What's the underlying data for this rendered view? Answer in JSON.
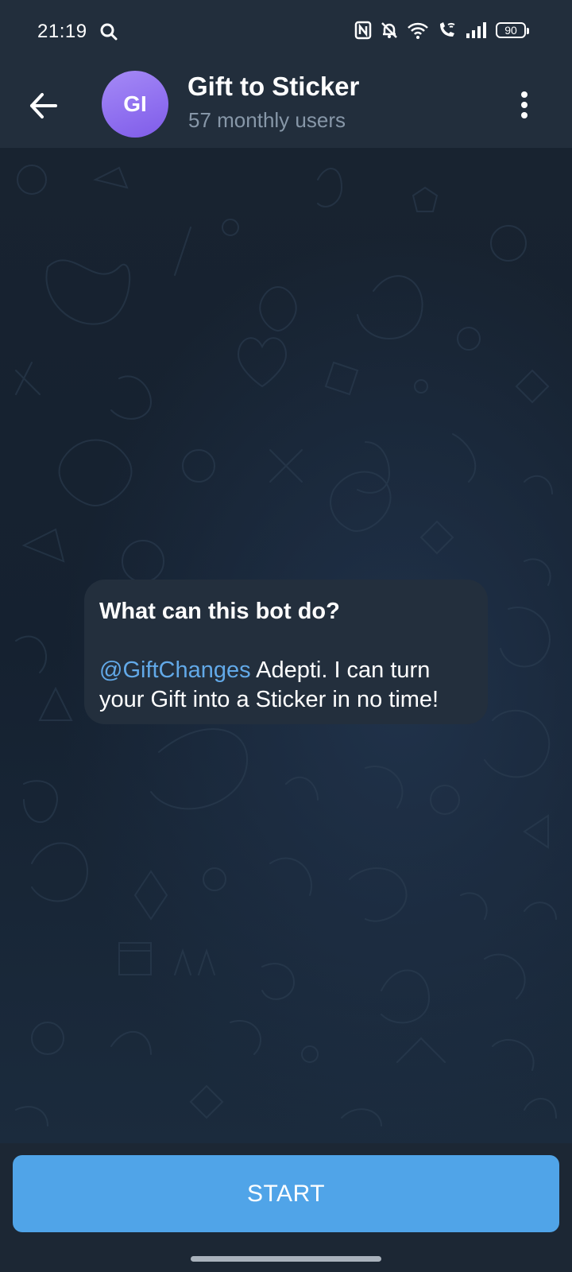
{
  "status_bar": {
    "time": "21:19",
    "battery": "90",
    "icons": [
      "search-icon",
      "nfc-icon",
      "mute-bell-icon",
      "wifi-icon",
      "wifi-call-icon",
      "signal-icon",
      "battery-icon"
    ]
  },
  "header": {
    "avatar_initials": "GI",
    "title": "Gift to Sticker",
    "subtitle": "57 monthly users",
    "back_icon": "arrow-left-icon",
    "menu_icon": "more-vertical-icon"
  },
  "intro_message": {
    "title": "What can this bot do?",
    "mention": "@GiftChanges",
    "text": " Adepti. I can turn your Gift into a Sticker in no time!"
  },
  "actions": {
    "start_label": "START"
  },
  "colors": {
    "header_bg": "#222e3c",
    "bubble_bg": "#232f3d",
    "link": "#62a9e8",
    "start_button": "#50a4e8",
    "avatar": "#8e6eef"
  }
}
